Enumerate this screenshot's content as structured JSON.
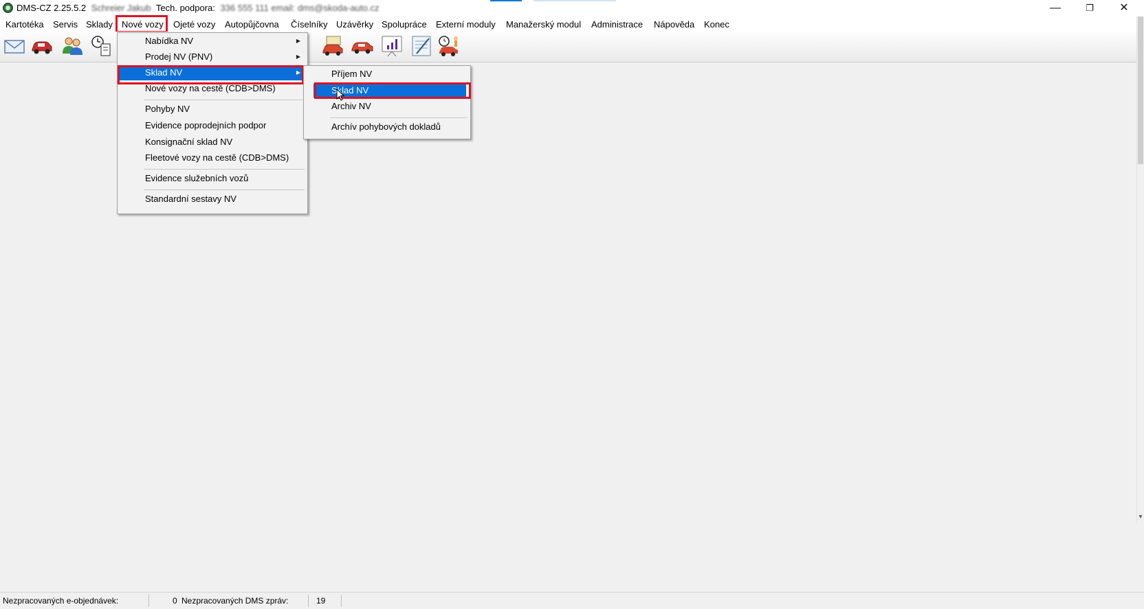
{
  "window": {
    "title_app": "DMS-CZ 2.25.5.2",
    "title_user": "Schreier Jakub",
    "title_support_label": "Tech. podpora:",
    "title_support_contact": "336 555 111 email: dms@skoda-auto.cz",
    "minimize": "—",
    "restore": "❐",
    "close": "✕"
  },
  "menubar": {
    "items": [
      "Kartotéka",
      "Servis",
      "Sklady",
      "Nové vozy",
      "Ojeté vozy",
      "Autopůjčovna",
      "Číselníky",
      "Uzávěrky",
      "Spolupráce",
      "Externí moduly",
      "Manažerský modul",
      "Administrace",
      "Nápověda",
      "Konec"
    ],
    "active": "Nové vozy"
  },
  "toolbar": {
    "icons": [
      "mail-icon",
      "car-icon",
      "users-icon",
      "clock-document-icon",
      "car-dark-icon",
      "car-map-icon",
      "car-red-icon",
      "presentation-chart-icon",
      "checklist-icon",
      "clock-person-car-icon"
    ]
  },
  "menu_nove_vozy": {
    "items": [
      {
        "label": "Nabídka NV",
        "submenu": true
      },
      {
        "label": "Prodej NV (PNV)",
        "submenu": true
      },
      {
        "label": "Sklad NV",
        "submenu": true,
        "highlighted": true
      },
      {
        "label": "Nové vozy na cestě (CDB>DMS)",
        "submenu": false
      },
      {
        "label": "Pohyby NV",
        "submenu": false
      },
      {
        "label": "Evidence poprodejních podpor",
        "submenu": false
      },
      {
        "label": "Konsignační sklad NV",
        "submenu": false
      },
      {
        "label": "Fleetové vozy na cestě (CDB>DMS)",
        "submenu": false
      },
      {
        "label": "Evidence služebních vozů",
        "submenu": false
      },
      {
        "label": "Standardní sestavy NV",
        "submenu": false
      }
    ]
  },
  "menu_sklad_nv": {
    "items": [
      {
        "label": "Příjem NV"
      },
      {
        "label": "Sklad NV",
        "highlighted": true
      },
      {
        "label": "Archiv NV"
      },
      {
        "label": "Archív pohybových dokladů"
      }
    ]
  },
  "statusbar": {
    "eorders_label": "Nezpracovaných e-objednávek:",
    "eorders_value": "0",
    "dms_label": "Nezpracovaných DMS zpráv:",
    "dms_value": "19"
  },
  "colors": {
    "highlight": "#0a6fd8",
    "annotation_red": "#e01020"
  }
}
